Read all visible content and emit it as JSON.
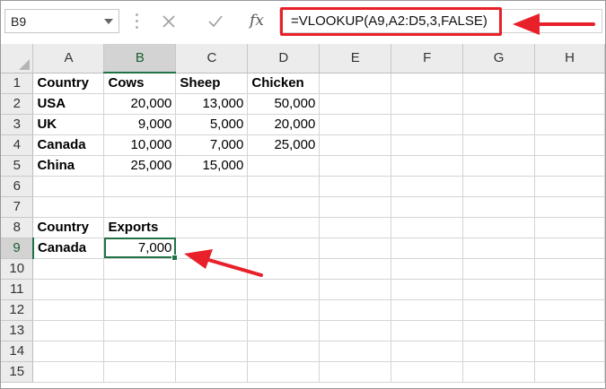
{
  "name_box": {
    "value": "B9"
  },
  "formula_bar": {
    "cancel_icon": "x-icon",
    "enter_icon": "checkmark-icon",
    "fx_label": "fx",
    "formula": "=VLOOKUP(A9,A2:D5,3,FALSE)"
  },
  "columns": [
    "A",
    "B",
    "C",
    "D",
    "E",
    "F",
    "G",
    "H"
  ],
  "rows": [
    {
      "num": "1",
      "cells": [
        "Country",
        "Cows",
        "Sheep",
        "Chicken",
        "",
        "",
        "",
        ""
      ]
    },
    {
      "num": "2",
      "cells": [
        "USA",
        "20,000",
        "13,000",
        "50,000",
        "",
        "",
        "",
        ""
      ]
    },
    {
      "num": "3",
      "cells": [
        "UK",
        "9,000",
        "5,000",
        "20,000",
        "",
        "",
        "",
        ""
      ]
    },
    {
      "num": "4",
      "cells": [
        "Canada",
        "10,000",
        "7,000",
        "25,000",
        "",
        "",
        "",
        ""
      ]
    },
    {
      "num": "5",
      "cells": [
        "China",
        "25,000",
        "15,000",
        "",
        "",
        "",
        "",
        ""
      ]
    },
    {
      "num": "6",
      "cells": [
        "",
        "",
        "",
        "",
        "",
        "",
        "",
        ""
      ]
    },
    {
      "num": "7",
      "cells": [
        "",
        "",
        "",
        "",
        "",
        "",
        "",
        ""
      ]
    },
    {
      "num": "8",
      "cells": [
        "Country",
        "Exports",
        "",
        "",
        "",
        "",
        "",
        ""
      ]
    },
    {
      "num": "9",
      "cells": [
        "Canada",
        "7,000",
        "",
        "",
        "",
        "",
        "",
        ""
      ]
    },
    {
      "num": "10",
      "cells": [
        "",
        "",
        "",
        "",
        "",
        "",
        "",
        ""
      ]
    },
    {
      "num": "11",
      "cells": [
        "",
        "",
        "",
        "",
        "",
        "",
        "",
        ""
      ]
    },
    {
      "num": "12",
      "cells": [
        "",
        "",
        "",
        "",
        "",
        "",
        "",
        ""
      ]
    },
    {
      "num": "13",
      "cells": [
        "",
        "",
        "",
        "",
        "",
        "",
        "",
        ""
      ]
    },
    {
      "num": "14",
      "cells": [
        "",
        "",
        "",
        "",
        "",
        "",
        "",
        ""
      ]
    },
    {
      "num": "15",
      "cells": [
        "",
        "",
        "",
        "",
        "",
        "",
        "",
        ""
      ]
    }
  ],
  "colors": {
    "header_blue": "#1f7ab8",
    "header_red": "#e0282e",
    "selection_green": "#217346",
    "annotation_red": "#e8202a"
  }
}
